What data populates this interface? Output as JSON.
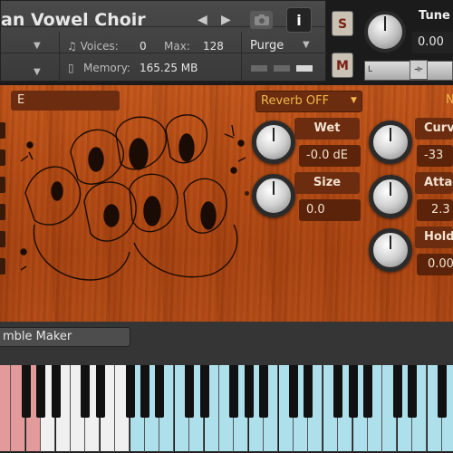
{
  "header": {
    "title": "an Vowel Choir",
    "nav_prev": "◀",
    "nav_next": "▶",
    "camera_icon": "camera-icon",
    "info_label": "i",
    "voices_label": "♫ Voices:",
    "voices_value": "0",
    "max_label": "Max:",
    "max_value": "128",
    "memory_label": "Memory:",
    "memory_value": "165.25 MB",
    "purge_label": "Purge",
    "dropdown_arrow": "▼",
    "solo_label": "S",
    "mute_label": "M",
    "tune_label": "Tune",
    "tune_value": "0.00",
    "pan_left_label": "L"
  },
  "panel": {
    "selector_value": "E",
    "reverb_value": "Reverb OFF",
    "reverb_arrow": "▼",
    "edge_label": "N",
    "controls": [
      {
        "label": "Wet",
        "value": "-0.0 dE"
      },
      {
        "label": "Size",
        "value": "0.0"
      },
      {
        "label": "Curve",
        "value": "-33"
      },
      {
        "label": "Attac",
        "value": "2.3"
      },
      {
        "label": "Hold",
        "value": "0.00"
      }
    ]
  },
  "ensemble": {
    "button_label": "mble Maker"
  },
  "colors": {
    "wood": "#b24a14",
    "label_bg": "#6b2c0f",
    "reverb_text": "#f2b84b",
    "key_red": "#e39a9a",
    "key_white": "#f0f0f0",
    "key_blue": "#aee0ec"
  },
  "keyboard": {
    "white_key_count": 31,
    "key_colors": [
      "red",
      "red",
      "red",
      "white",
      "white",
      "white",
      "white",
      "white",
      "white",
      "blue",
      "blue",
      "blue",
      "blue",
      "blue",
      "blue",
      "blue",
      "blue",
      "blue",
      "blue",
      "blue",
      "blue",
      "blue",
      "blue",
      "blue",
      "blue",
      "blue",
      "blue",
      "blue",
      "blue",
      "blue",
      "blue"
    ]
  }
}
